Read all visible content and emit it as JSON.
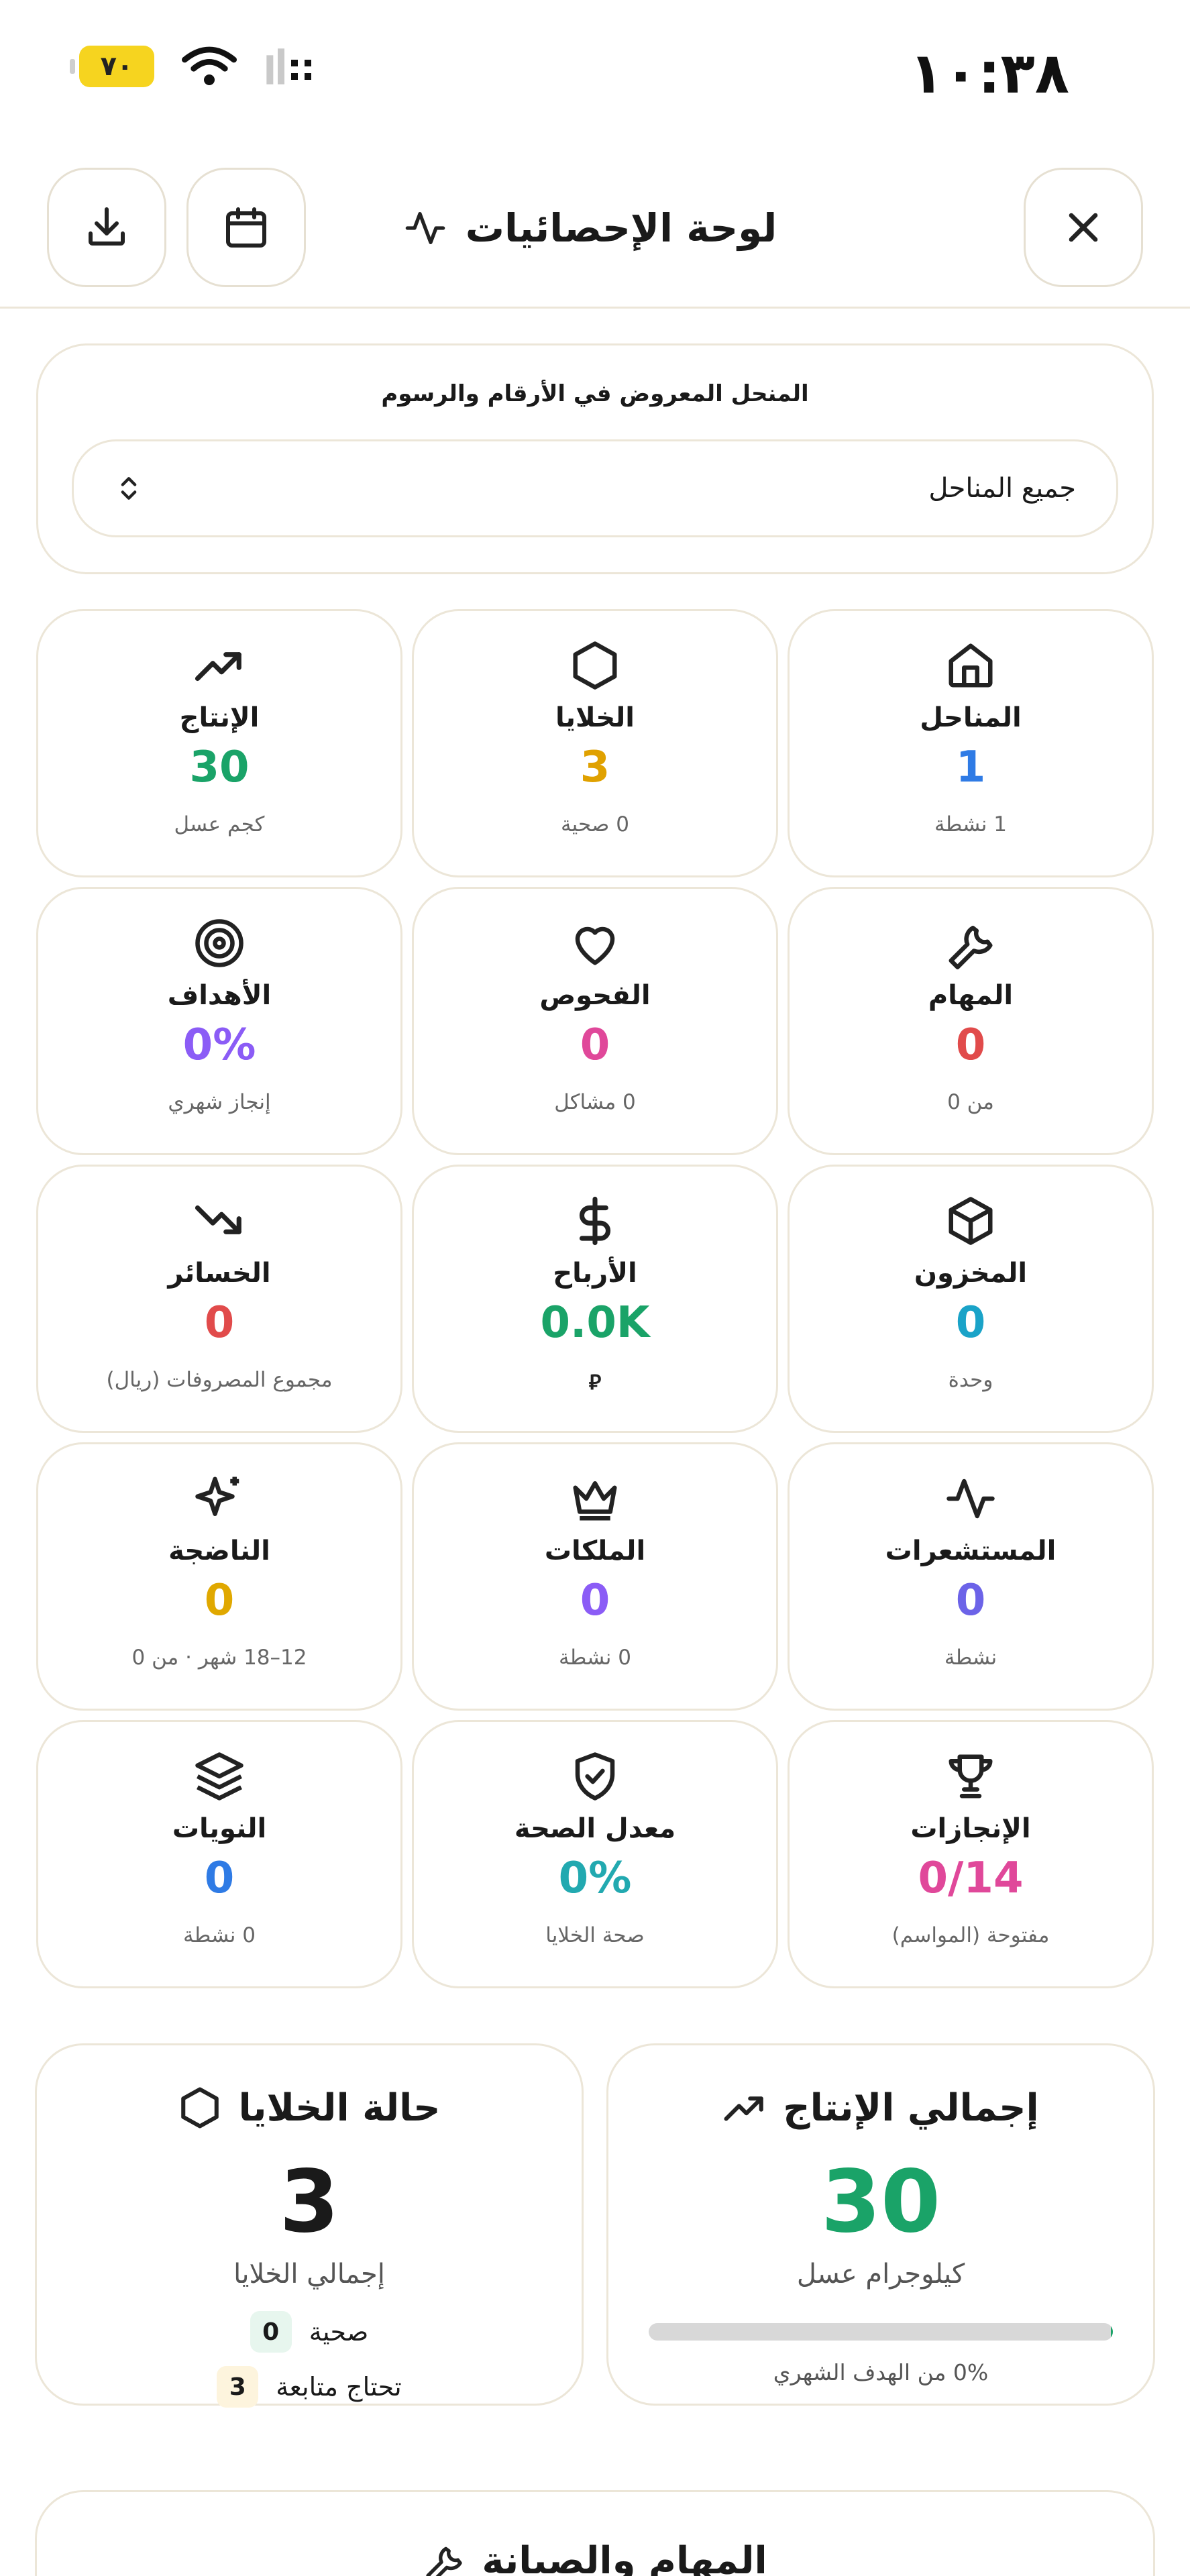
{
  "status_bar": {
    "time": "١٠:٣٨",
    "battery": "٧٠"
  },
  "header": {
    "title": "لوحة الإحصائيات"
  },
  "filter": {
    "label": "المنحل المعروض في الأرقام والرسوم",
    "selected": "جميع المناحل"
  },
  "stats": {
    "apiaries": {
      "label": "المناحل",
      "value": "1",
      "sub": "1 نشطة"
    },
    "hives": {
      "label": "الخلايا",
      "value": "3",
      "sub": "0 صحية"
    },
    "production": {
      "label": "الإنتاج",
      "value": "30",
      "sub": "كجم عسل"
    },
    "tasks": {
      "label": "المهام",
      "value": "0",
      "sub": "من 0"
    },
    "inspections": {
      "label": "الفحوص",
      "value": "0",
      "sub": "0 مشاكل"
    },
    "goals": {
      "label": "الأهداف",
      "value": "0%",
      "sub": "إنجاز شهري"
    },
    "inventory": {
      "label": "المخزون",
      "value": "0",
      "sub": "وحدة"
    },
    "profits": {
      "label": "الأرباح",
      "value": "0.0K",
      "sub": "⃁"
    },
    "losses": {
      "label": "الخسائر",
      "value": "0",
      "sub": "مجموع المصروفات (ريال)"
    },
    "sensors": {
      "label": "المستشعرات",
      "value": "0",
      "sub": "نشطة"
    },
    "queens": {
      "label": "الملكات",
      "value": "0",
      "sub": "0 نشطة"
    },
    "mature": {
      "label": "الناضجة",
      "value": "0",
      "sub": "12–18 شهر · من 0"
    },
    "achievements": {
      "label": "الإنجازات",
      "value": "0/14",
      "sub": "مفتوحة (المواسم)"
    },
    "health": {
      "label": "معدل الصحة",
      "value": "0%",
      "sub": "صحة الخلايا"
    },
    "shifts": {
      "label": "النويات",
      "value": "0",
      "sub": "0 نشطة"
    }
  },
  "production_summary": {
    "title": "إجمالي الإنتاج",
    "value": "30",
    "unit": "كيلوجرام عسل",
    "progress_percent": 0,
    "note": "0% من الهدف الشهري"
  },
  "hives_summary": {
    "title": "حالة الخلايا",
    "value": "3",
    "unit": "إجمالي الخلايا",
    "healthy_label": "صحية",
    "healthy_count": "0",
    "followup_label": "تحتاج متابعة",
    "followup_count": "3"
  },
  "tasks_section": {
    "title": "المهام والصيانة"
  },
  "colors": {
    "green": "#1aa368",
    "orange": "#e0a100",
    "blue": "#2f7be5",
    "purple": "#8b5cf6",
    "red": "#e14b4b",
    "cyan": "#1aa3c8",
    "teal": "#22a9b0",
    "pink": "#e0489a",
    "border": "#ece6d8",
    "battery": "#f6d41f"
  }
}
